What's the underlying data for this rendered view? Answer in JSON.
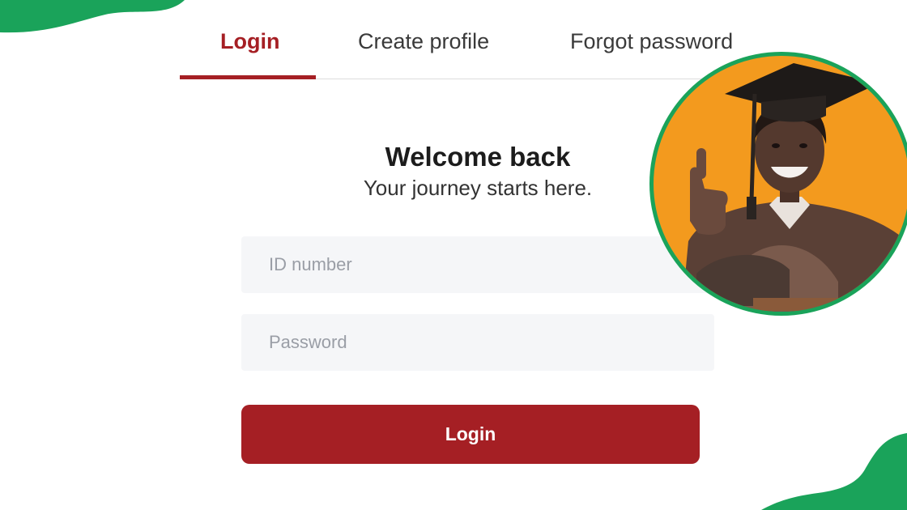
{
  "tabs": [
    {
      "label": "Login",
      "active": true
    },
    {
      "label": "Create profile",
      "active": false
    },
    {
      "label": "Forgot password",
      "active": false
    }
  ],
  "welcome": {
    "title": "Welcome back",
    "subtitle": "Your journey starts here."
  },
  "form": {
    "id_placeholder": "ID number",
    "password_placeholder": "Password",
    "submit_label": "Login"
  },
  "colors": {
    "accent": "#a51f24",
    "brand_green": "#1aa35a",
    "photo_background": "#f39a1e",
    "field_background": "#f5f6f8"
  },
  "icons": [
    "graduate-photo",
    "decorative-blob"
  ]
}
